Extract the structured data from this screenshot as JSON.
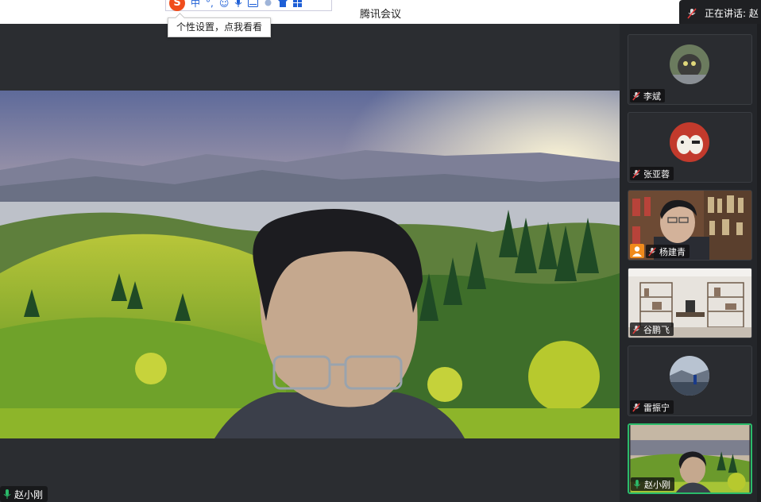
{
  "app": {
    "title": "腾讯会议"
  },
  "ime": {
    "logo": "S",
    "mode": "中",
    "punct": "°,",
    "tooltip": "个性设置，点我看看"
  },
  "speaking": {
    "label": "正在讲话: 赵"
  },
  "main_video": {
    "participant": "赵小刚",
    "mic": "on"
  },
  "participants": [
    {
      "name": "李斌",
      "mic": "muted",
      "avatar": "cat-photo-avatar"
    },
    {
      "name": "张亚蓉",
      "mic": "muted",
      "avatar": "cartoon-avatar"
    },
    {
      "name": "杨建青",
      "mic": "muted",
      "video": "bookshelf-camera",
      "host": true
    },
    {
      "name": "谷鹏飞",
      "mic": "muted",
      "video": "room-background"
    },
    {
      "name": "雷振宁",
      "mic": "muted",
      "avatar": "landscape-avatar"
    },
    {
      "name": "赵小刚",
      "mic": "on",
      "video": "self-camera",
      "active": true
    }
  ],
  "colors": {
    "active_border": "#2bbb6a",
    "mic_on": "#2bbb6a",
    "mic_muted": "#e33b3b",
    "host": "#f08a1c"
  }
}
